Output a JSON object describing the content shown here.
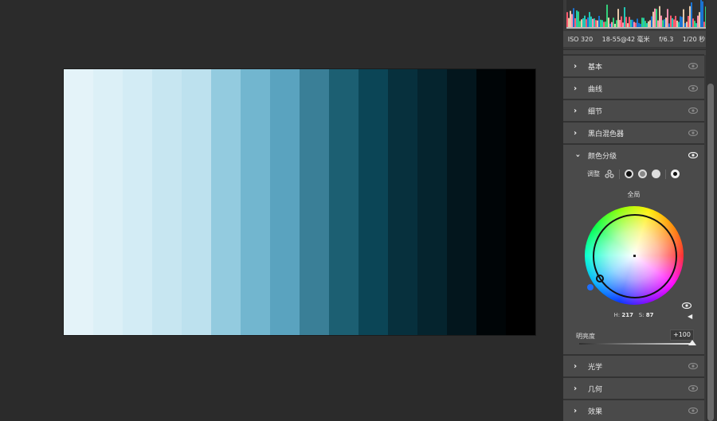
{
  "photo": {
    "stripes": [
      "#e4f3f9",
      "#dcf0f7",
      "#d3ecf5",
      "#c7e6f1",
      "#bde1ee",
      "#93cbdf",
      "#72b6cf",
      "#5aa3bf",
      "#3a7f97",
      "#1c5f72",
      "#0b4556",
      "#07303d",
      "#05242e",
      "#03161d",
      "#000507",
      "#000000"
    ]
  },
  "histogram": {
    "label": "histogram"
  },
  "exif": {
    "iso": "ISO 320",
    "lens": "18-55@42 毫米",
    "aperture": "f/6.3",
    "shutter": "1/20 秒"
  },
  "sections_top": [
    {
      "label": "基本"
    },
    {
      "label": "曲线"
    },
    {
      "label": "细节"
    },
    {
      "label": "黑白混色器"
    }
  ],
  "color_grading": {
    "label": "颜色分级",
    "adjust_label": "调整",
    "global_label": "全局",
    "hue_label": "H:",
    "hue_value": "217",
    "sat_label": "S:",
    "sat_value": "87",
    "luminance_label": "明亮度",
    "luminance_value": "+100",
    "luminance_fraction": 1.0
  },
  "sections_bottom": [
    {
      "label": "光学"
    },
    {
      "label": "几何"
    },
    {
      "label": "效果"
    }
  ]
}
